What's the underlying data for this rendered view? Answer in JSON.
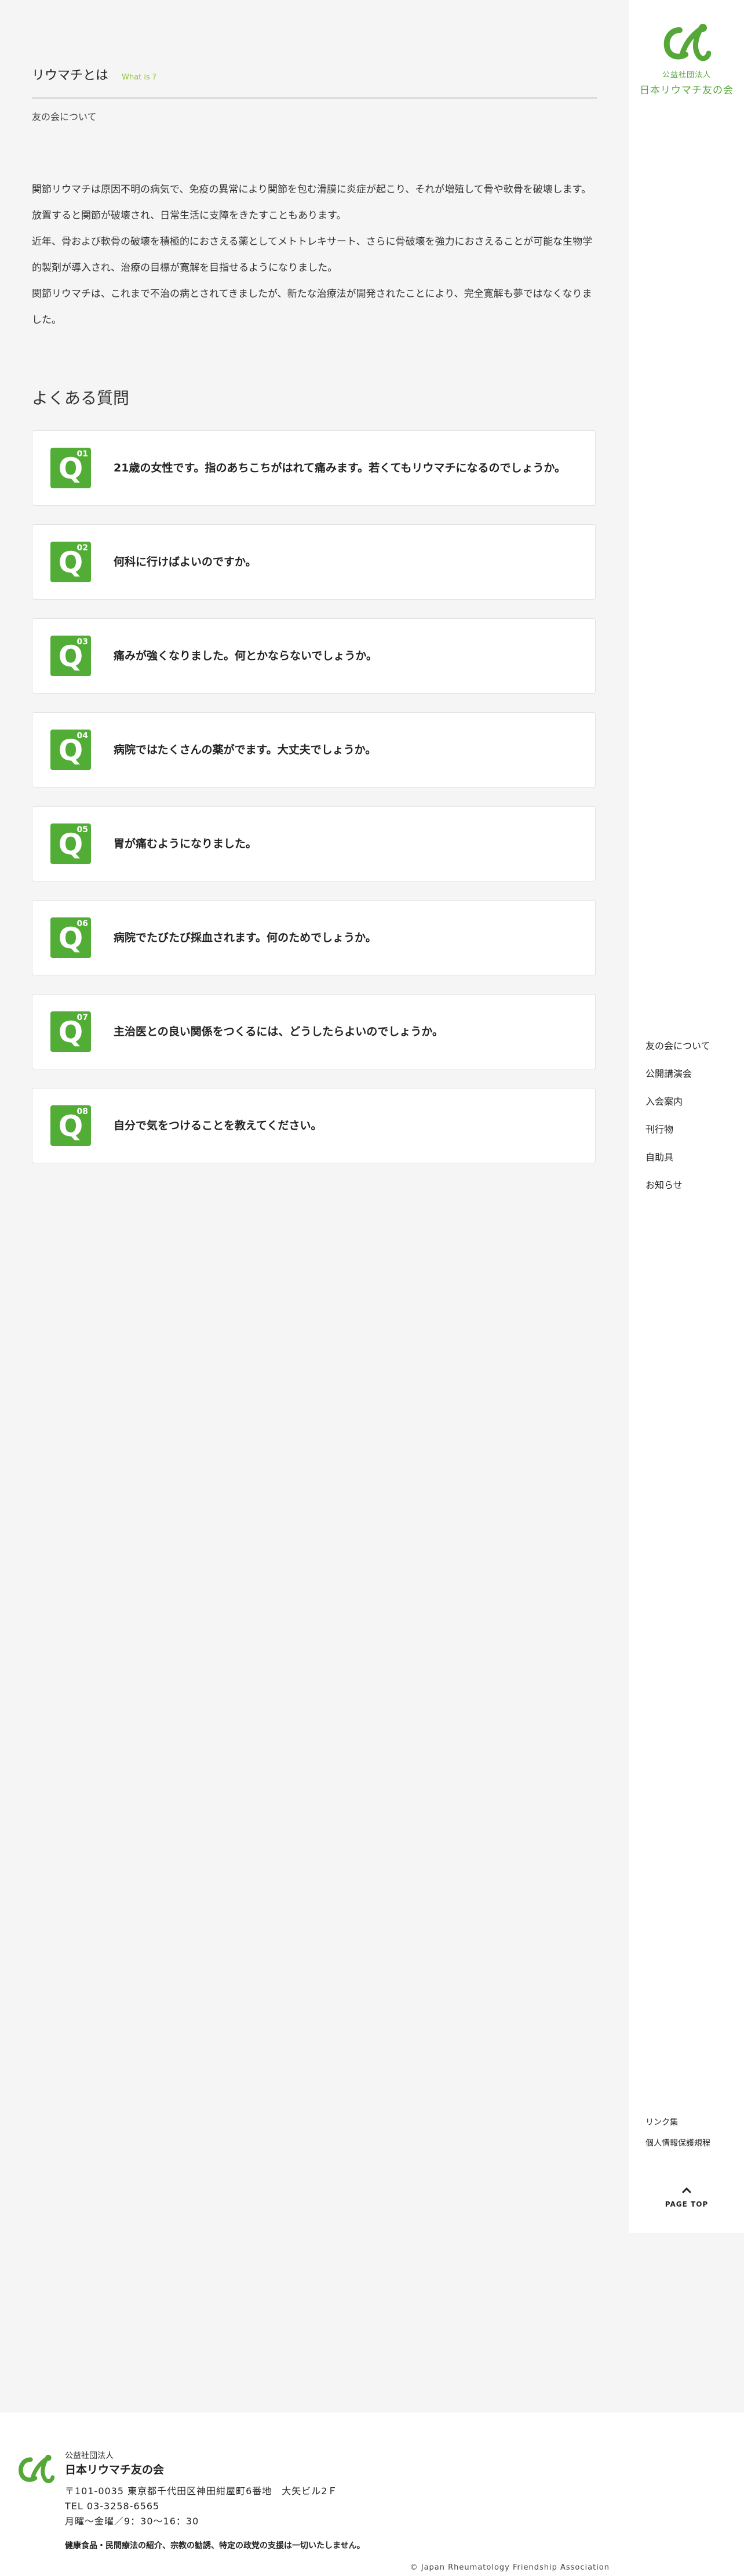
{
  "brand": {
    "sub": "公益社団法人",
    "main": "日本リウマチ友の会",
    "color": "#55a838"
  },
  "page": {
    "title": "リウマチとは",
    "title_en": "What is ?",
    "breadcrumb": "友の会について"
  },
  "intro": [
    "関節リウマチは原因不明の病気で、免疫の異常により関節を包む滑膜に炎症が起こり、それが増殖して骨や軟骨を破壊します。放置すると関節が破壊され、日常生活に支障をきたすこともあります。",
    "近年、骨および軟骨の破壊を積極的におさえる薬としてメトトレキサート、さらに骨破壊を強力におさえることが可能な生物学的製剤が導入され、治療の目標が寛解を目指せるようになりました。",
    "関節リウマチは、これまで不治の病とされてきましたが、新たな治療法が開発されたことにより、完全寛解も夢ではなくなりました。"
  ],
  "faq": {
    "title": "よくある質問",
    "badge_color": "#52ad36",
    "items": [
      {
        "num": "01",
        "q": "Q",
        "text": "21歳の女性です。指のあちこちがはれて痛みます。若くてもリウマチになるのでしょうか。"
      },
      {
        "num": "02",
        "q": "Q",
        "text": "何科に行けばよいのですか。"
      },
      {
        "num": "03",
        "q": "Q",
        "text": "痛みが強くなりました。何とかならないでしょうか。"
      },
      {
        "num": "04",
        "q": "Q",
        "text": "病院ではたくさんの薬がでます。大丈夫でしょうか。"
      },
      {
        "num": "05",
        "q": "Q",
        "text": "胃が痛むようになりました。"
      },
      {
        "num": "06",
        "q": "Q",
        "text": "病院でたびたび採血されます。何のためでしょうか。"
      },
      {
        "num": "07",
        "q": "Q",
        "text": "主治医との良い関係をつくるには、どうしたらよいのでしょうか。"
      },
      {
        "num": "08",
        "q": "Q",
        "text": "自分で気をつけることを教えてください。"
      }
    ]
  },
  "sidebar": {
    "nav": [
      "友の会について",
      "公開講演会",
      "入会案内",
      "刊行物",
      "自助具",
      "お知らせ"
    ],
    "sub": [
      "リンク集",
      "個人情報保護規程"
    ],
    "pagetop": "PAGE TOP"
  },
  "footer": {
    "org_sub": "公益社団法人",
    "org_main": "日本リウマチ友の会",
    "address": "〒101-0035 東京都千代田区神田紺屋町6番地　大矢ビル2Ｆ",
    "tel": "TEL 03-3258-6565",
    "hours": "月曜～金曜／9：30～16：30",
    "note": "健康食品・民間療法の紹介、宗教の勧誘、特定の政党の支援は一切いたしません。",
    "copyright": "© Japan Rheumatology Friendship Association"
  }
}
